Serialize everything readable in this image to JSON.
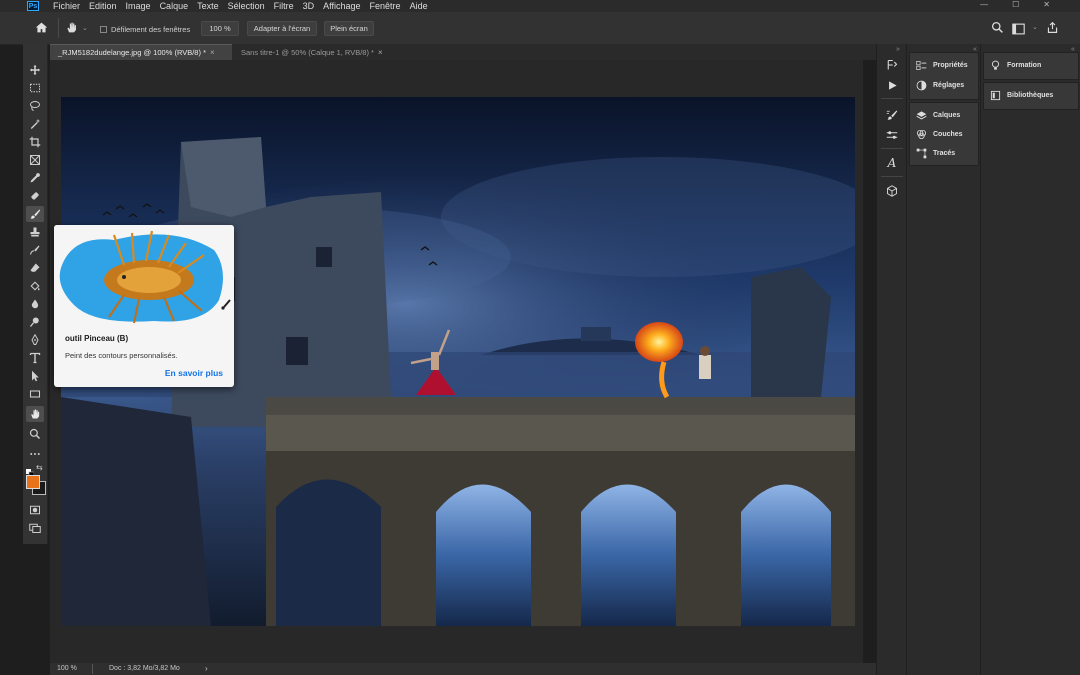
{
  "app": {
    "logo": "Ps"
  },
  "menu": [
    "Fichier",
    "Edition",
    "Image",
    "Calque",
    "Texte",
    "Sélection",
    "Filtre",
    "3D",
    "Affichage",
    "Fenêtre",
    "Aide"
  ],
  "window_controls": {
    "minimize": "—",
    "maximize": "☐",
    "close": "✕"
  },
  "options": {
    "scroll_all_label": "Défilement des fenêtres",
    "zoom_value": "100 %",
    "fit_button": "Adapter à l'écran",
    "fullscreen_button": "Plein écran"
  },
  "tabs": [
    {
      "label": "_RJM5182dudelange.jpg @ 100% (RVB/8) *",
      "close": "×"
    },
    {
      "label": "Sans titre-1 @ 50% (Calque 1, RVB/8) *",
      "close": "×"
    }
  ],
  "tooltip": {
    "title": "outil Pinceau (B)",
    "description": "Peint des contours personnalisés.",
    "link": "En savoir plus"
  },
  "status": {
    "zoom": "100 %",
    "doc": "Doc : 3,82 Mo/3,82 Mo",
    "arrow": "›"
  },
  "panels": {
    "col1": [
      "Propriétés",
      "Réglages",
      "Calques",
      "Couches",
      "Tracés"
    ],
    "col2": [
      "Formation",
      "Bibliothèques"
    ]
  },
  "colors": {
    "accent": "#1473e6",
    "foreground": "#e8731a",
    "background": "#1a1a1a"
  }
}
